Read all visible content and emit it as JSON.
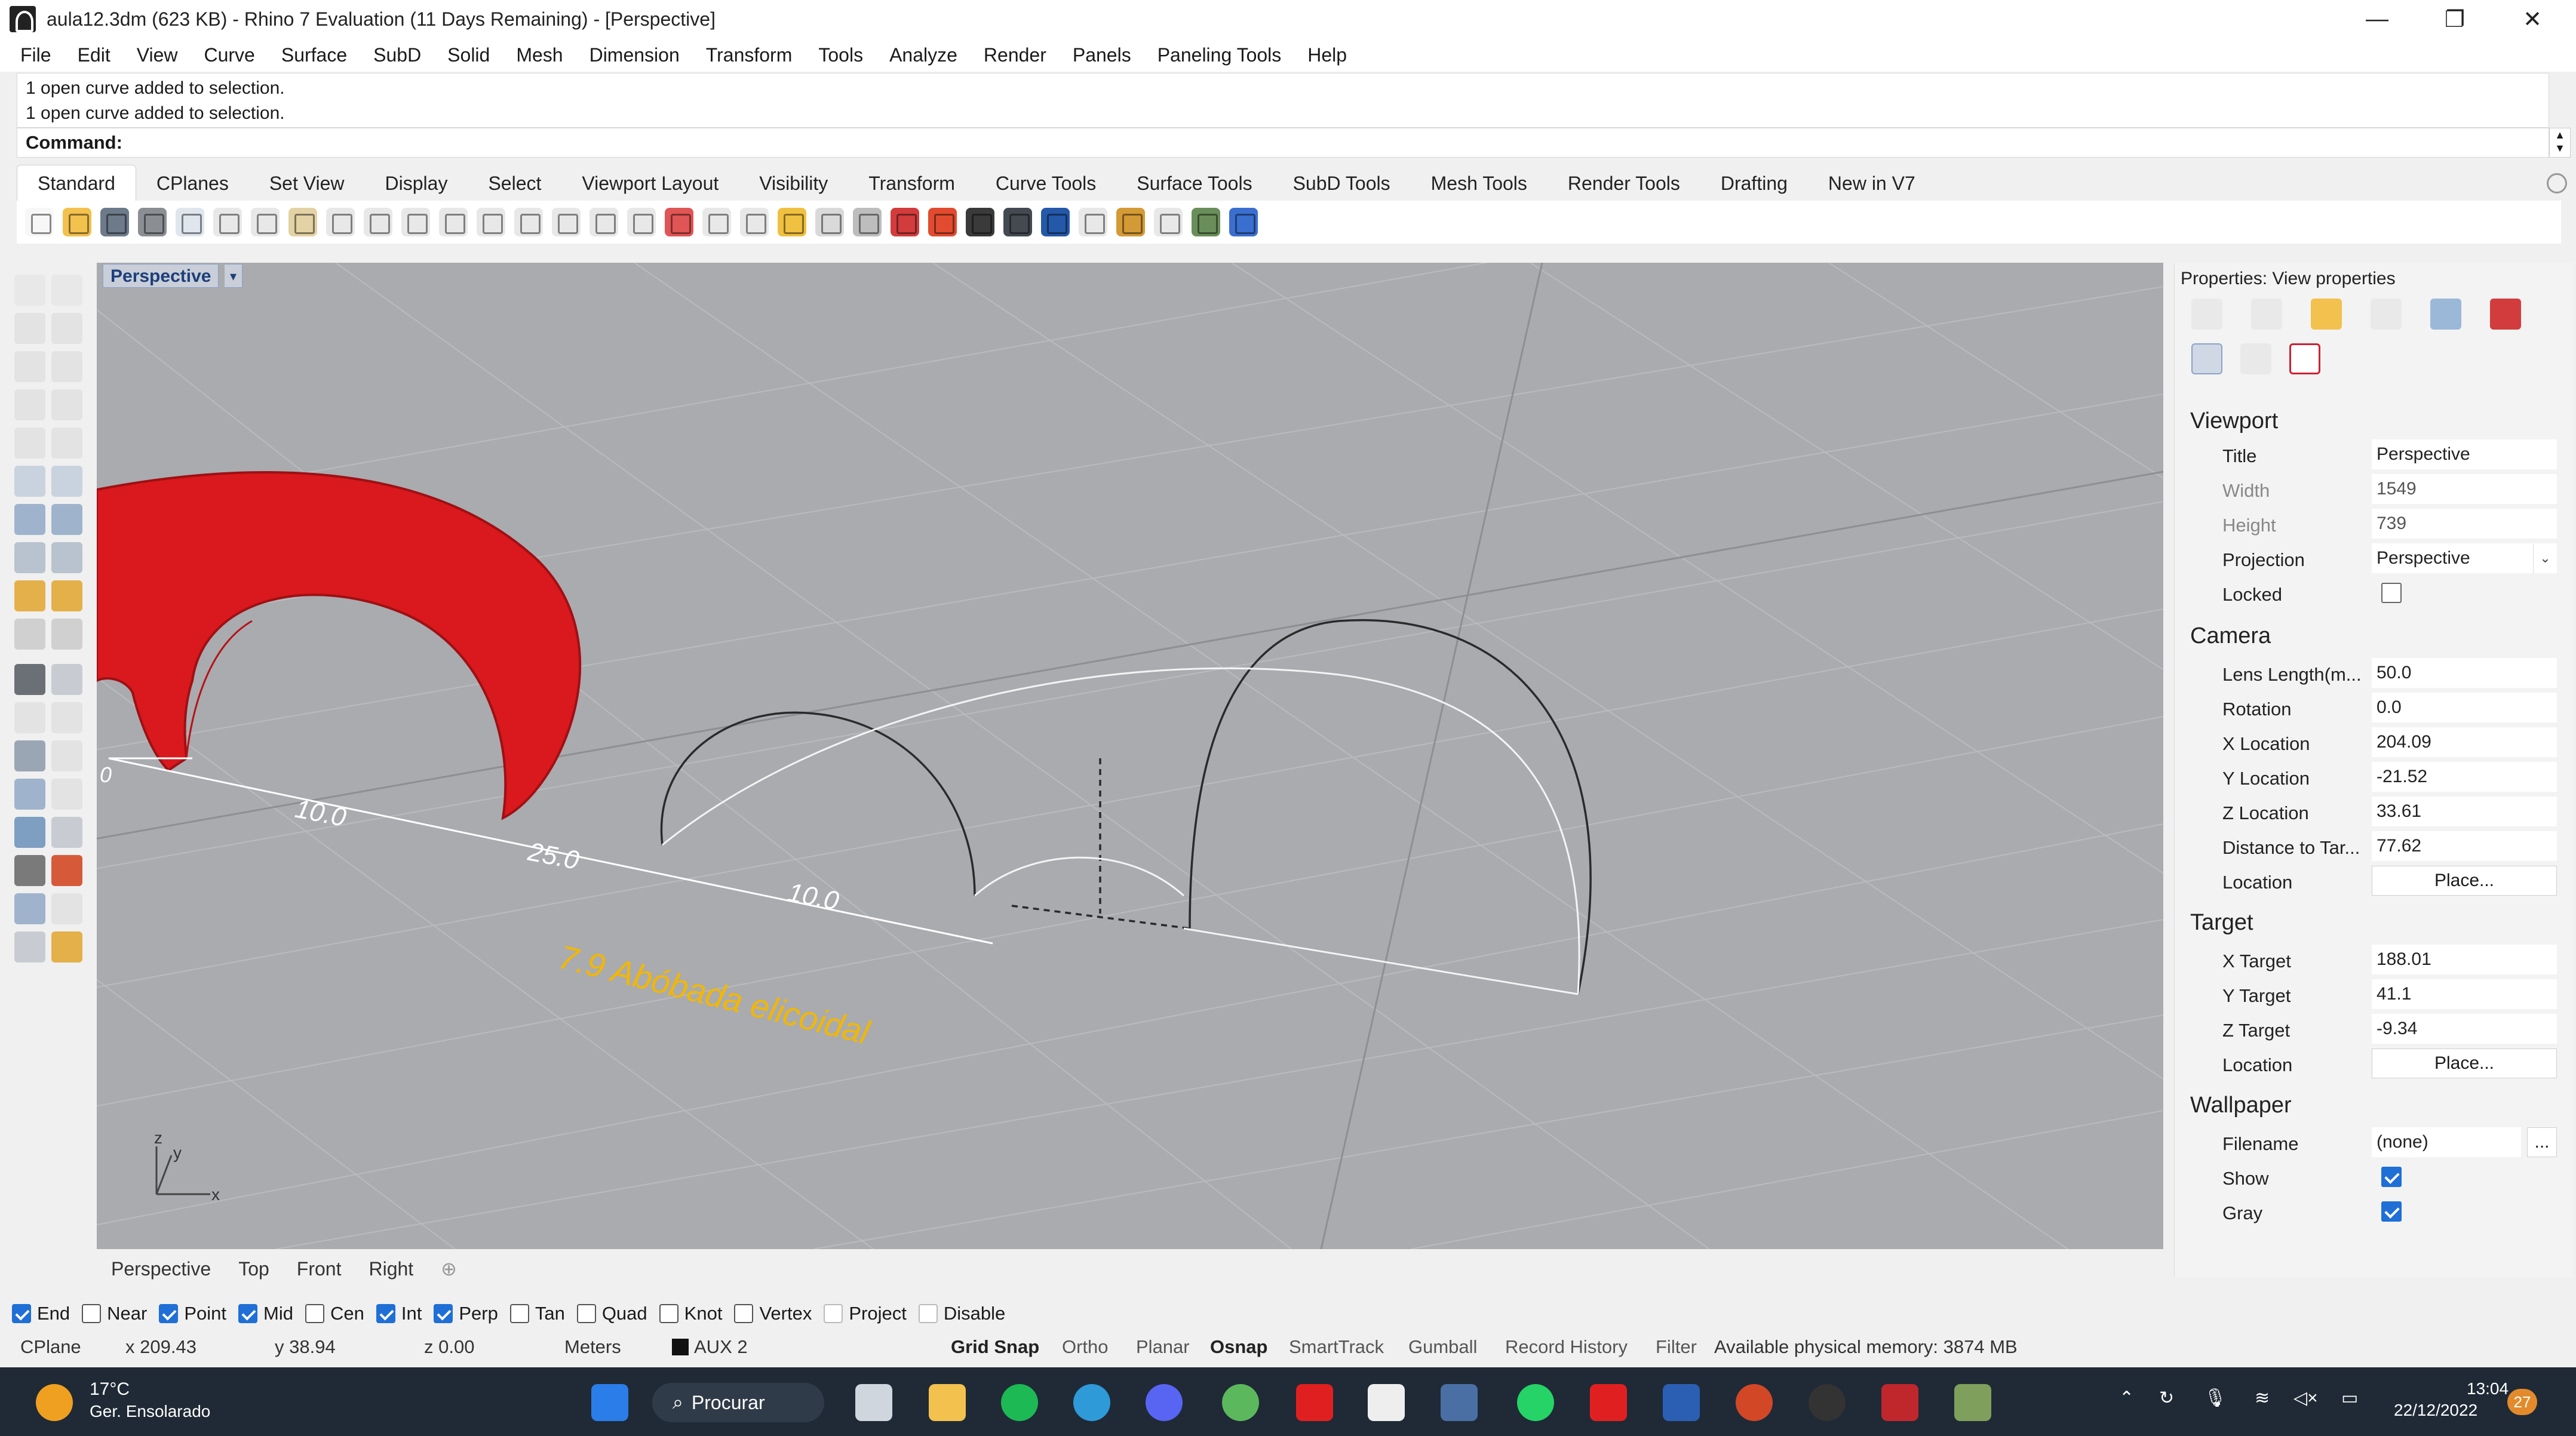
{
  "window": {
    "title": "aula12.3dm (623 KB) - Rhino 7 Evaluation (11 Days Remaining) - [Perspective]",
    "minimize": "—",
    "restore": "❐",
    "close": "✕"
  },
  "menu": [
    "File",
    "Edit",
    "View",
    "Curve",
    "Surface",
    "SubD",
    "Solid",
    "Mesh",
    "Dimension",
    "Transform",
    "Tools",
    "Analyze",
    "Render",
    "Panels",
    "Paneling Tools",
    "Help"
  ],
  "command": {
    "history": [
      "1 open curve added to selection.",
      "1 open curve added to selection."
    ],
    "prompt": "Command:"
  },
  "toolbar_tabs": [
    "Standard",
    "CPlanes",
    "Set View",
    "Display",
    "Select",
    "Viewport Layout",
    "Visibility",
    "Transform",
    "Curve Tools",
    "Surface Tools",
    "SubD Tools",
    "Mesh Tools",
    "Render Tools",
    "Drafting",
    "New in V7"
  ],
  "viewport": {
    "title": "Perspective",
    "dims": [
      "10.0",
      "25.0",
      "10.0"
    ],
    "zero": "0",
    "annotation": "7.9 Abóbada elicoidal",
    "axis_x": "x",
    "axis_y": "y",
    "axis_z": "z",
    "colors": {
      "background": "#a9abaf",
      "surface": "#d9191d",
      "annotation": "#f2b705"
    }
  },
  "viewport_tabs": [
    "Perspective",
    "Top",
    "Front",
    "Right",
    "⊕"
  ],
  "properties": {
    "header": "Properties: View properties",
    "viewport_section": "Viewport",
    "camera_section": "Camera",
    "target_section": "Target",
    "wallpaper_section": "Wallpaper",
    "title_label": "Title",
    "title_value": "Perspective",
    "width_label": "Width",
    "width_value": "1549",
    "height_label": "Height",
    "height_value": "739",
    "projection_label": "Projection",
    "projection_value": "Perspective",
    "locked_label": "Locked",
    "lens_label": "Lens Length(m...",
    "lens_value": "50.0",
    "rotation_label": "Rotation",
    "rotation_value": "0.0",
    "xloc_label": "X Location",
    "xloc_value": "204.09",
    "yloc_label": "Y Location",
    "yloc_value": "-21.52",
    "zloc_label": "Z Location",
    "zloc_value": "33.61",
    "dist_label": "Distance to Tar...",
    "dist_value": "77.62",
    "location_label": "Location",
    "place_label": "Place...",
    "xtarget_label": "X Target",
    "xtarget_value": "188.01",
    "ytarget_label": "Y Target",
    "ytarget_value": "41.1",
    "ztarget_label": "Z Target",
    "ztarget_value": "-9.34",
    "filename_label": "Filename",
    "filename_value": "(none)",
    "browse": "...",
    "show_label": "Show",
    "gray_label": "Gray",
    "dropdown": "⌄"
  },
  "osnap": {
    "end": "End",
    "near": "Near",
    "point": "Point",
    "mid": "Mid",
    "cen": "Cen",
    "int": "Int",
    "perp": "Perp",
    "tan": "Tan",
    "quad": "Quad",
    "knot": "Knot",
    "vertex": "Vertex",
    "project": "Project",
    "disable": "Disable"
  },
  "status": {
    "cplane": "CPlane",
    "x": "x 209.43",
    "y": "y 38.94",
    "z": "z 0.00",
    "units": "Meters",
    "layer": "AUX 2",
    "grid_snap": "Grid Snap",
    "ortho": "Ortho",
    "planar": "Planar",
    "osnap": "Osnap",
    "smarttrack": "SmartTrack",
    "gumball": "Gumball",
    "record_history": "Record History",
    "filter": "Filter",
    "memory": "Available physical memory: 3874 MB"
  },
  "taskbar": {
    "temp": "17°C",
    "weather": "Ger. Ensolarado",
    "search": "Procurar",
    "time": "13:04",
    "date": "22/12/2022",
    "notifications": "27"
  }
}
